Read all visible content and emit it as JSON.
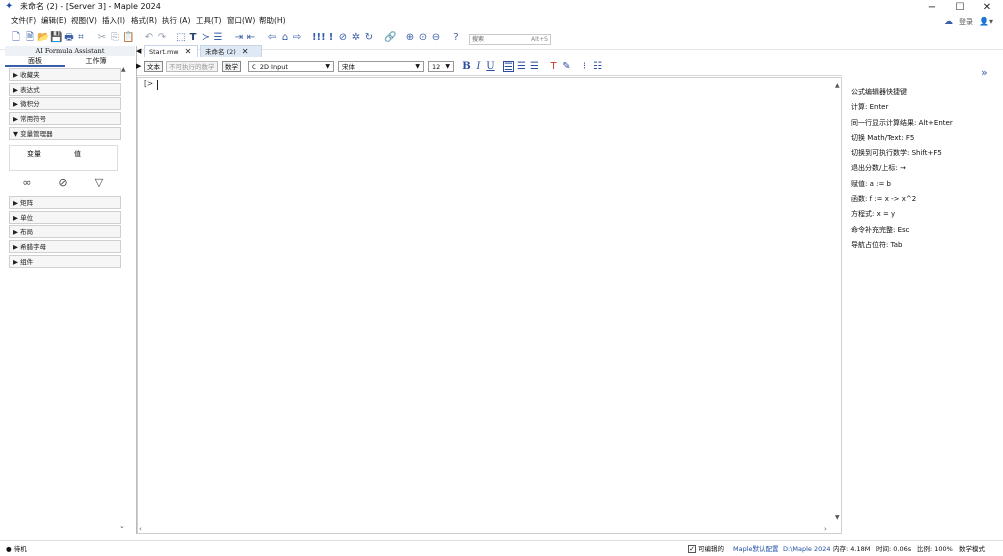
{
  "window": {
    "title": "未命名 (2) - [Server 3] - Maple 2024",
    "minimize_icon": "minimize-icon",
    "maximize_icon": "maximize-icon",
    "close_icon": "close-icon"
  },
  "menubar": {
    "items": [
      "文件(F)",
      "编辑(E)",
      "视图(V)",
      "插入(I)",
      "格式(R)",
      "执行 (A)",
      "工具(T)",
      "窗口(W)",
      "帮助(H)"
    ],
    "login_label": "登录"
  },
  "toolbar": {
    "search_placeholder": "搜索",
    "search_shortcut": "Alt+S"
  },
  "left_panel": {
    "header": "AI Formula Assistant",
    "tabs": [
      "面板",
      "工作簿"
    ],
    "sections_top": [
      "收藏夹",
      "表达式",
      "微积分",
      "常用符号",
      "变量管理器"
    ],
    "var_table": {
      "col1": "变量",
      "col2": "值"
    },
    "sections_bottom": [
      "矩阵",
      "单位",
      "布局",
      "希腊字母",
      "组件"
    ]
  },
  "doc_tabs": [
    {
      "label": "Start.mw"
    },
    {
      "label": "未命名 (2)"
    }
  ],
  "context_bar": {
    "text_btn": "文本",
    "nonexec_btn": "不可执行的数学",
    "math_btn": "数学",
    "input_mode": "2D Input",
    "font": "宋体",
    "size": "12"
  },
  "document": {
    "prompt": "[>"
  },
  "right_panel": {
    "title": "公式编辑器快捷键",
    "lines": [
      "计算: Enter",
      "同一行显示计算结果: Alt+Enter",
      "切换 Math/Text: F5",
      "切换到可执行数学: Shift+F5",
      "退出分数/上标: →",
      "赋值: a := b",
      "函数: f := x -> x^2",
      "方程式: x = y",
      "命令补充完整: Esc",
      "导航占位符: Tab"
    ]
  },
  "status_bar": {
    "state": "待机",
    "editable_label": "可编辑的",
    "config": "Maple默认配置",
    "path": "D:\\Maple 2024",
    "memory": "内存: 4.18M",
    "time": "时间: 0.06s",
    "zoom": "比例: 100%",
    "mode": "数学模式"
  }
}
